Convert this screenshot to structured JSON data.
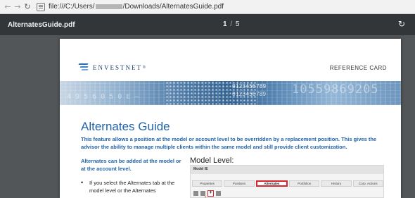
{
  "browser": {
    "back_icon": "arrow-left-icon",
    "back_glyph": "←",
    "forward_icon": "arrow-right-icon",
    "forward_glyph": "→",
    "reload_icon": "reload-icon",
    "reload_glyph": "↻",
    "url_prefix": "file:///C:/Users/",
    "url_suffix": "/Downloads/AlternatesGuide.pdf"
  },
  "pdf_viewer": {
    "title": "AlternatesGuide.pdf",
    "current_page": "1",
    "separator": "/",
    "total_pages": "5",
    "rotate_icon": "rotate-icon",
    "rotate_glyph": "↻",
    "toolbar_bg": "#323639",
    "viewer_bg": "#525659"
  },
  "document": {
    "brand": "ENVESTNET",
    "brand_mark": "®",
    "header_right": "REFERENCE CARD",
    "banner_text": {
      "left": "4 9 5 6 0 5 0 E —",
      "mid1": "0123456789",
      "mid2": "0123456789",
      "right": "10559869205"
    },
    "title": "Alternates Guide",
    "description": "This feature allows a position at the model or account level to be overridden by a replacement position. This gives the advisor the ability to manage multiple clients within the same model and still provide client customization.",
    "left_column": {
      "lead": "Alternates can be added at the model or at the account level.",
      "bullet": "If you select the Alternates tab at the model level or the Alternates"
    },
    "figure": {
      "label": "Model Level:",
      "header": "Model IE",
      "tabs": [
        "Properties",
        "Positions",
        "Alternates",
        "Portfolios",
        "History",
        "Corp. Actions"
      ],
      "active_tab": "Alternates",
      "plus_glyph": "+"
    },
    "accent_color": "#1f63a8",
    "highlight_color": "#d9232d"
  }
}
